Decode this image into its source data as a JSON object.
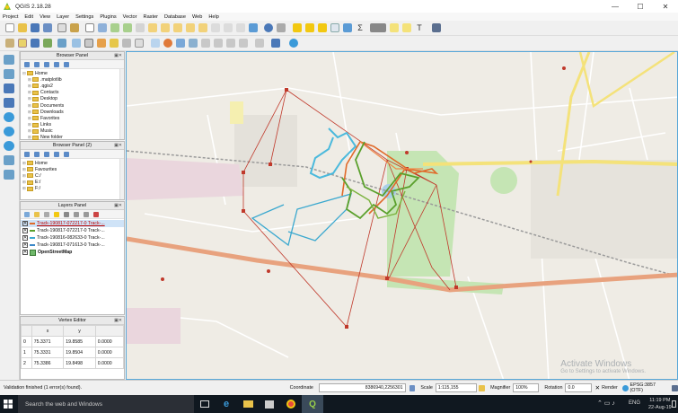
{
  "window": {
    "title": "QGIS 2.18.28"
  },
  "window_buttons": [
    "—",
    "☐",
    "✕"
  ],
  "menu": [
    "Project",
    "Edit",
    "View",
    "Layer",
    "Settings",
    "Plugins",
    "Vector",
    "Raster",
    "Database",
    "Web",
    "Help"
  ],
  "browser_panel": {
    "title": "Browser Panel",
    "items": [
      "Home",
      ".matplotlib",
      ".qgis2",
      "Contacts",
      "Desktop",
      "Documents",
      "Downloads",
      "Favorites",
      "Links",
      "Music",
      "New folder"
    ]
  },
  "browser_panel2": {
    "title": "Browser Panel (2)",
    "items": [
      "Home",
      "Favourites",
      "C:/",
      "E:/",
      "F:/"
    ]
  },
  "layers_panel": {
    "title": "Layers Panel",
    "layers": [
      {
        "name": "Track-190817-072217-0 Track-...",
        "checked": "✕",
        "color": "#e06a2a",
        "selected": true
      },
      {
        "name": "Track-190817-072217-0 Track-...",
        "checked": "✕",
        "color": "#5aa02c",
        "selected": false
      },
      {
        "name": "Track-190816-082633-0 Track-...",
        "checked": "✕",
        "color": "#3aa8cf",
        "selected": false
      },
      {
        "name": "Track-190817-071613-0 Track-...",
        "checked": "✕",
        "color": "#3b88c8",
        "selected": false
      },
      {
        "name": "OpenStreetMap",
        "checked": "✕",
        "color": "",
        "selected": false
      }
    ]
  },
  "vertex_editor": {
    "title": "Vertex Editor",
    "columns": [
      "",
      "x",
      "y",
      ""
    ],
    "rows": [
      [
        "0",
        "75.3371",
        "19.8585",
        "0.0000"
      ],
      [
        "1",
        "75.3331",
        "19.8504",
        "0.0000"
      ],
      [
        "2",
        "75.3386",
        "19.8498",
        "0.0000"
      ]
    ]
  },
  "map": {
    "watermark_title": "Activate Windows",
    "watermark_sub": "Go to Settings to activate Windows."
  },
  "status": {
    "message": "Validation finished (1 error(s) found).",
    "coordinate_label": "Coordinate",
    "coordinate_value": "8386940,2256301",
    "scale_label": "Scale",
    "scale_value": "1:115,155",
    "magnifier_label": "Magnifier",
    "magnifier_value": "100%",
    "rotation_label": "Rotation",
    "rotation_value": "0.0",
    "render_label": "Render",
    "crs": "EPSG:3857 (OTF)"
  },
  "taskbar": {
    "search_placeholder": "Search the web and Windows",
    "lang": "ENG",
    "time": "11:19 PM",
    "date": "22-Aug-19"
  },
  "colors": {
    "orange_track": "#e06a2a",
    "green_track": "#5aa02c",
    "cyan_track": "#3aa8cf",
    "red_lines": "#c0392b",
    "major_road": "#e8a27e",
    "yellow_road": "#f4e27a",
    "park": "#c5e5b4",
    "map_bg": "#efece5"
  }
}
